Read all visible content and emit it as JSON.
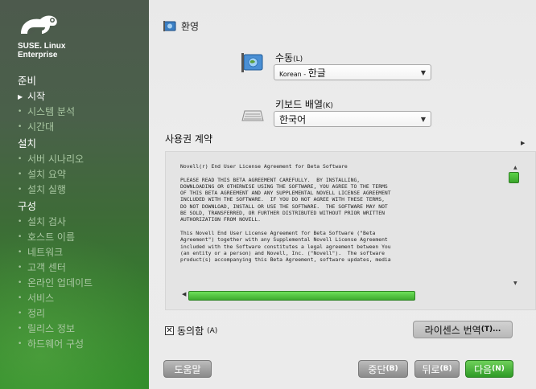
{
  "sidebar": {
    "brand_line1": "SUSE. Linux",
    "brand_line2": "Enterprise",
    "sections": [
      {
        "label": "준비",
        "items": [
          {
            "label": "시작",
            "current": true
          },
          {
            "label": "시스템 분석",
            "current": false
          },
          {
            "label": "시간대",
            "current": false
          }
        ]
      },
      {
        "label": "설치",
        "items": [
          {
            "label": "서버 시나리오",
            "current": false
          },
          {
            "label": "설치 요약",
            "current": false
          },
          {
            "label": "설치 실행",
            "current": false
          }
        ]
      },
      {
        "label": "구성",
        "items": [
          {
            "label": "설치 검사",
            "current": false
          },
          {
            "label": "호스트 이름",
            "current": false
          },
          {
            "label": "네트워크",
            "current": false
          },
          {
            "label": "고객 센터",
            "current": false
          },
          {
            "label": "온라인 업데이트",
            "current": false
          },
          {
            "label": "서비스",
            "current": false
          },
          {
            "label": "정리",
            "current": false
          },
          {
            "label": "릴리스 정보",
            "current": false
          },
          {
            "label": "하드웨어 구성",
            "current": false
          }
        ]
      }
    ]
  },
  "main": {
    "title": "환영",
    "language_label": "수동",
    "language_mnemonic": "(L)",
    "language_value_prefix": "Korean - ",
    "language_value_main": "한글",
    "keyboard_label": "키보드 배열",
    "keyboard_mnemonic": "(K)",
    "keyboard_value": "한국어",
    "license_heading": "사용권 계약",
    "license_text": "Novell(r) End User License Agreement for Beta Software\n\nPLEASE READ THIS BETA AGREEMENT CAREFULLY.  BY INSTALLING,\nDOWNLOADING OR OTHERWISE USING THE SOFTWARE, YOU AGREE TO THE TERMS\nOF THIS BETA AGREEMENT AND ANY SUPPLEMENTAL NOVELL LICENSE AGREEMENT\nINCLUDED WITH THE SOFTWARE.  IF YOU DO NOT AGREE WITH THESE TERMS,\nDO NOT DOWNLOAD, INSTALL OR USE THE SOFTWARE.  THE SOFTWARE MAY NOT\nBE SOLD, TRANSFERRED, OR FURTHER DISTRIBUTED WITHOUT PRIOR WRITTEN\nAUTHORIZATION FROM NOVELL.\n\nThis Novell End User License Agreement for Beta Software (\"Beta\nAgreement\") together with any Supplemental Novell License Agreement\nincluded with the Software constitutes a legal agreement between You\n(an entity or a person) and Novell, Inc. (\"Novell\").  The software\nproduct(s) accompanying this Beta Agreement, software updates, media",
    "agree_label": "동의함",
    "agree_mnemonic": "(A)",
    "agree_checked": "✕",
    "license_translations_label": "라이센스 번역",
    "license_translations_mnemonic": "(T)...",
    "help_label": "도움말",
    "abort_label": "중단",
    "abort_mnemonic": "(B)",
    "back_label": "뒤로",
    "back_mnemonic": "(B)",
    "next_label": "다음",
    "next_mnemonic": "(N)"
  },
  "colors": {
    "accent_green": "#3aa52b",
    "sidebar_dim_text": "#a9c7a2"
  }
}
